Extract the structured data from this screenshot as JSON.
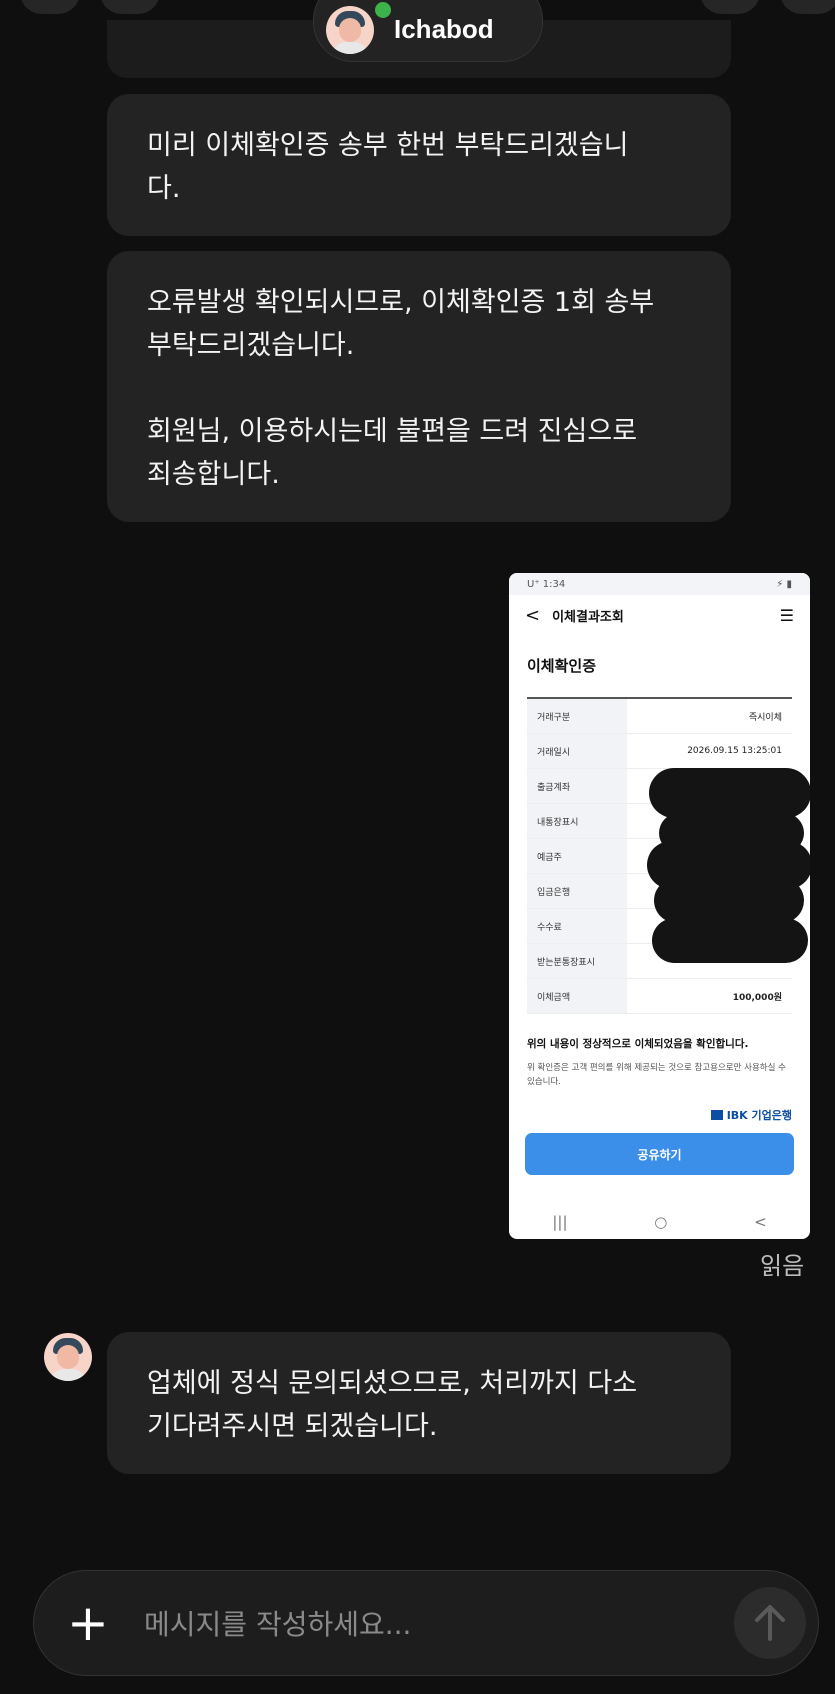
{
  "header": {
    "agent_name": "Ichabod"
  },
  "messages": [
    "미리 이체확인증 송부 한번 부탁드리겠습니\n다.",
    "오류발생 확인되시므로, 이체확인증 1회 송부\n부탁드리겠습니다.\n\n회원님, 이용하시는데 불편을 드려 진심으로\n죄송합니다.",
    "업체에 정식 문의되셨으므로, 처리까지 다소\n기다려주시면 되겠습니다."
  ],
  "attachment": {
    "status_time": "U⁺ 1:34",
    "nav_title": "이체결과조회",
    "title": "이체확인증",
    "rows": [
      {
        "label": "거래구분",
        "value": "즉시이체"
      },
      {
        "label": "거래일시",
        "value": "2026.09.15 13:25:01"
      },
      {
        "label": "출금계좌",
        "value": ""
      },
      {
        "label": "내통장표시",
        "value": ""
      },
      {
        "label": "예금주",
        "value": ""
      },
      {
        "label": "입금은행",
        "value": ""
      },
      {
        "label": "수수료",
        "value": ""
      },
      {
        "label": "받는분통장표시",
        "value": ""
      },
      {
        "label": "이체금액",
        "value": "100,000원"
      }
    ],
    "confirm_text": "위의 내용이 정상적으로 이체되었음을 확인합니다.",
    "note": "위 확인증은 고객 편의를 위해 제공되는 것으로 참고용으로만 사용하실 수 있습니다.",
    "bank": "IBK 기업은행",
    "share_label": "공유하기",
    "read_label": "읽음"
  },
  "composer": {
    "placeholder": "메시지를 작성하세요..."
  }
}
